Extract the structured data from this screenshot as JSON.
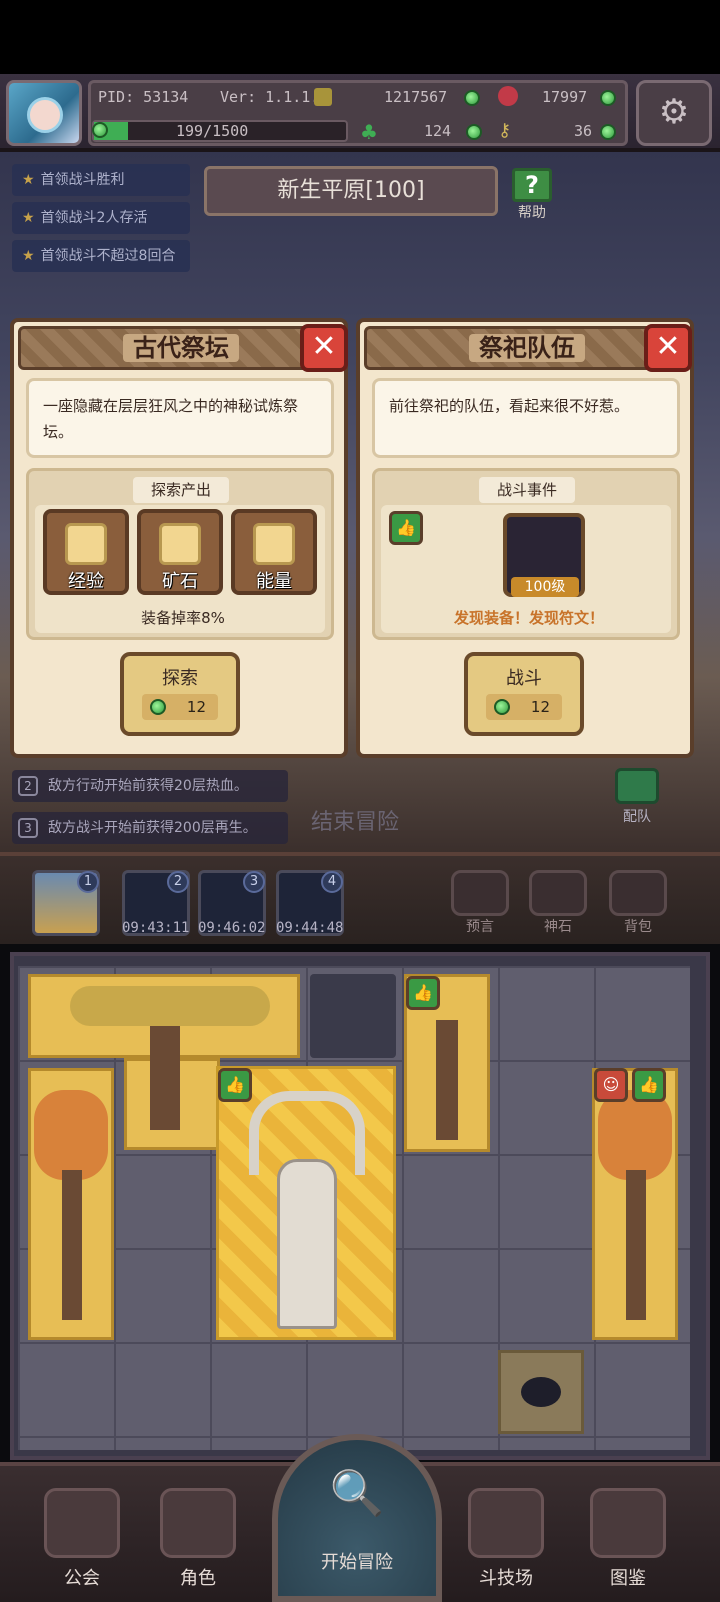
{
  "header": {
    "pid": "PID: 53134",
    "version": "Ver: 1.1.1.5",
    "gold": "1217567",
    "hearts": "17997",
    "xp": "199/1500",
    "xp_fraction": 0.133,
    "clover": "124",
    "keys": "36"
  },
  "quests": [
    "首领战斗胜利",
    "首领战斗2人存活",
    "首领战斗不超过8回合"
  ],
  "level": {
    "title": "新生平原[100]",
    "help_label": "帮助"
  },
  "altar_card": {
    "title": "古代祭坛",
    "description": "一座隐藏在层层狂风之中的神秘试炼祭坛。",
    "section_title": "探索产出",
    "rewards": [
      "经验",
      "矿石",
      "能量"
    ],
    "drop_rate": "装备掉率8%",
    "button_label": "探索",
    "cost": "12"
  },
  "team_card": {
    "title": "祭祀队伍",
    "description": "前往祭祀的队伍，看起来很不好惹。",
    "section_title": "战斗事件",
    "enemy_level": "100级",
    "finds": "发现装备！发现符文！",
    "button_label": "战斗",
    "cost": "12"
  },
  "events": [
    {
      "num": "2",
      "text": "敌方行动开始前获得20层热血。"
    },
    {
      "num": "3",
      "text": "敌方战斗开始前获得200层再生。"
    }
  ],
  "end_adventure": "结束冒险",
  "team_label": "配队",
  "slots": [
    {
      "num": "1",
      "time": ""
    },
    {
      "num": "2",
      "time": "09:43:11"
    },
    {
      "num": "3",
      "time": "09:46:02"
    },
    {
      "num": "4",
      "time": "09:44:48"
    }
  ],
  "side_buttons": [
    "预言",
    "神石",
    "背包"
  ],
  "nav": {
    "guild": "公会",
    "character": "角色",
    "start": "开始冒险",
    "arena": "斗技场",
    "codex": "图鉴"
  },
  "colors": {
    "accent_green": "#3fae54",
    "close_red": "#d9443a",
    "gold_tile": "#e7be55"
  }
}
